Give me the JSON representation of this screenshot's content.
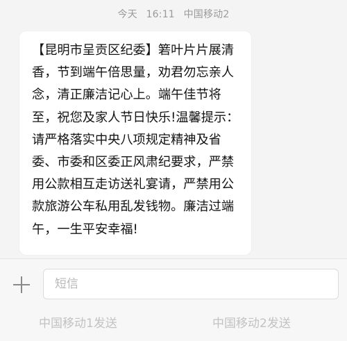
{
  "thread": {
    "timestamp": {
      "day": "今天",
      "time": "16:11",
      "carrier": "中国移动2"
    },
    "message": {
      "text": "【昆明市呈贡区纪委】箬叶片片展清香，节到端午倍思量，劝君勿忘亲人念，清正廉洁记心上。端午佳节将至，祝您及家人节日快乐!温馨提示：请严格落实中央八项规定精神及省委、市委和区委正风肃纪要求，严禁用公款相互走访送礼宴请，严禁用公款旅游公车私用乱发钱物。廉洁过端午，一生平安幸福!"
    }
  },
  "composer": {
    "plus_icon": "plus-icon",
    "input_placeholder": "短信",
    "input_value": "",
    "send_sim1_label": "中国移动1发送",
    "send_sim2_label": "中国移动2发送"
  },
  "colors": {
    "background": "#f4f4f4",
    "bubble": "#ffffff",
    "timestamp_text": "#9a9a9a",
    "send_label": "#c2c2c2"
  }
}
